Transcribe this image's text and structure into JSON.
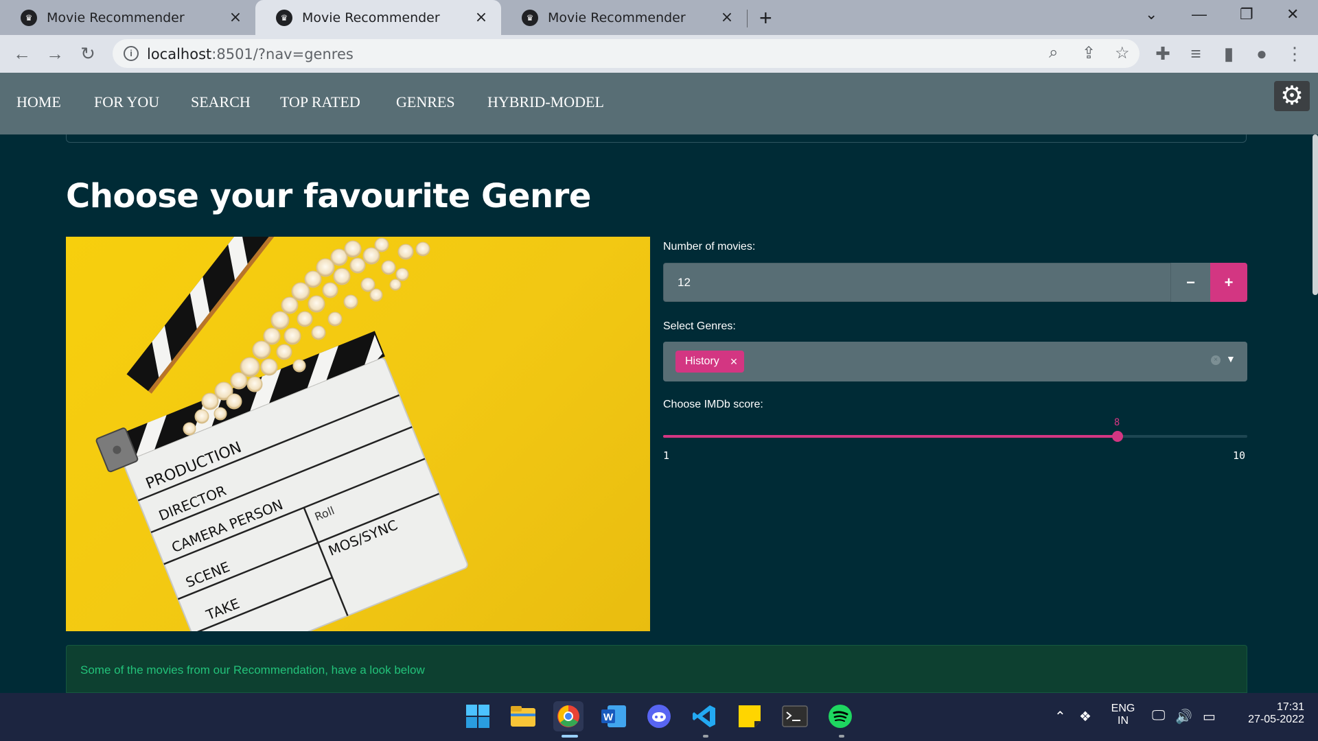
{
  "browser": {
    "tabs": [
      {
        "title": "Movie Recommender",
        "active": false
      },
      {
        "title": "Movie Recommender",
        "active": true
      },
      {
        "title": "Movie Recommender",
        "active": false
      }
    ],
    "url_host": "localhost",
    "url_rest": ":8501/?nav=genres"
  },
  "nav": {
    "items": [
      "HOME",
      "FOR YOU",
      "SEARCH",
      "TOP RATED",
      "GENRES",
      "HYBRID-MODEL"
    ]
  },
  "page": {
    "title": "Choose your favourite Genre"
  },
  "poster": {
    "clapper_lines": [
      "PRODUCTION",
      "DIRECTOR",
      "CAMERA PERSON",
      "SCENE",
      "TAKE",
      "Roll",
      "MOS/SYNC"
    ]
  },
  "controls": {
    "num_movies_label": "Number of movies:",
    "num_movies_value": "12",
    "minus_label": "−",
    "plus_label": "+",
    "genres_label": "Select Genres:",
    "selected_genre": "History",
    "imdb_label": "Choose IMDb score:",
    "imdb_value": "8",
    "imdb_min": "1",
    "imdb_max": "10"
  },
  "alert": {
    "text": "Some of the movies from our Recommendation, have a look below"
  },
  "taskbar": {
    "lang_top": "ENG",
    "lang_bottom": "IN",
    "time": "17:31",
    "date": "27-05-2022"
  },
  "colors": {
    "accent": "#d33682",
    "background": "#002b36",
    "nav": "#586e75"
  }
}
